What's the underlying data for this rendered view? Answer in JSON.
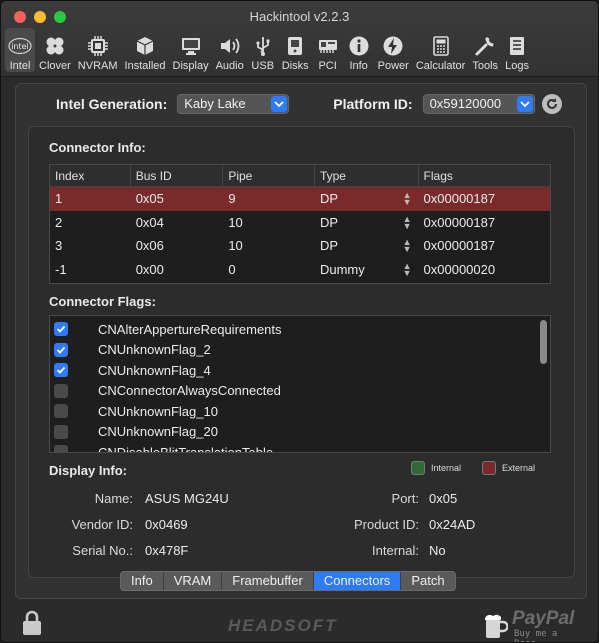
{
  "window": {
    "title": "Hackintool v2.2.3"
  },
  "toolbar": [
    {
      "label": "Intel",
      "icon": "intel-logo-icon",
      "active": true
    },
    {
      "label": "Clover",
      "icon": "clover-icon"
    },
    {
      "label": "NVRAM",
      "icon": "chip-icon"
    },
    {
      "label": "Installed",
      "icon": "package-icon"
    },
    {
      "label": "Display",
      "icon": "monitor-icon"
    },
    {
      "label": "Audio",
      "icon": "speaker-icon"
    },
    {
      "label": "USB",
      "icon": "usb-icon"
    },
    {
      "label": "Disks",
      "icon": "disk-icon"
    },
    {
      "label": "PCI",
      "icon": "pci-card-icon"
    },
    {
      "label": "Info",
      "icon": "info-icon"
    },
    {
      "label": "Power",
      "icon": "power-bolt-icon"
    },
    {
      "label": "Calculator",
      "icon": "calculator-icon"
    },
    {
      "label": "Tools",
      "icon": "wrench-icon"
    },
    {
      "label": "Logs",
      "icon": "logs-icon"
    }
  ],
  "generation": {
    "label": "Intel Generation:",
    "value": "Kaby Lake"
  },
  "platform": {
    "label": "Platform ID:",
    "value": "0x59120000"
  },
  "connector_info": {
    "title": "Connector Info:",
    "columns": [
      "Index",
      "Bus ID",
      "Pipe",
      "Type",
      "Flags"
    ],
    "rows": [
      {
        "index": "1",
        "bus": "0x05",
        "pipe": "9",
        "type": "DP",
        "flags": "0x00000187",
        "selected": true
      },
      {
        "index": "2",
        "bus": "0x04",
        "pipe": "10",
        "type": "DP",
        "flags": "0x00000187"
      },
      {
        "index": "3",
        "bus": "0x06",
        "pipe": "10",
        "type": "DP",
        "flags": "0x00000187"
      },
      {
        "index": "-1",
        "bus": "0x00",
        "pipe": "0",
        "type": "Dummy",
        "flags": "0x00000020"
      }
    ]
  },
  "connector_flags": {
    "title": "Connector Flags:",
    "items": [
      {
        "label": "CNAlterAppertureRequirements",
        "checked": true
      },
      {
        "label": "CNUnknownFlag_2",
        "checked": true
      },
      {
        "label": "CNUnknownFlag_4",
        "checked": true
      },
      {
        "label": "CNConnectorAlwaysConnected",
        "checked": false
      },
      {
        "label": "CNUnknownFlag_10",
        "checked": false
      },
      {
        "label": "CNUnknownFlag_20",
        "checked": false
      },
      {
        "label": "CNDisableBlitTranslationTable",
        "checked": false
      }
    ]
  },
  "display_info": {
    "title": "Display Info:",
    "legend": {
      "internal": "Internal",
      "external": "External",
      "internal_color": "#2f6b3a",
      "external_color": "#7a2a2a"
    },
    "name_label": "Name:",
    "name_value": "ASUS MG24U",
    "port_label": "Port:",
    "port_value": "0x05",
    "vendor_label": "Vendor ID:",
    "vendor_value": "0x0469",
    "product_label": "Product ID:",
    "product_value": "0x24AD",
    "serial_label": "Serial No.:",
    "serial_value": "0x478F",
    "internal_label": "Internal:",
    "internal_value": "No"
  },
  "tabs": [
    {
      "label": "Info"
    },
    {
      "label": "VRAM"
    },
    {
      "label": "Framebuffer"
    },
    {
      "label": "Connectors",
      "active": true
    },
    {
      "label": "Patch"
    }
  ],
  "footer": {
    "brand": "HEADSOFT",
    "paypal": "PayPal",
    "beer": "Buy me a Beer"
  },
  "colors": {
    "accent": "#2f7af7",
    "selected_row": "#7a2a2a"
  }
}
